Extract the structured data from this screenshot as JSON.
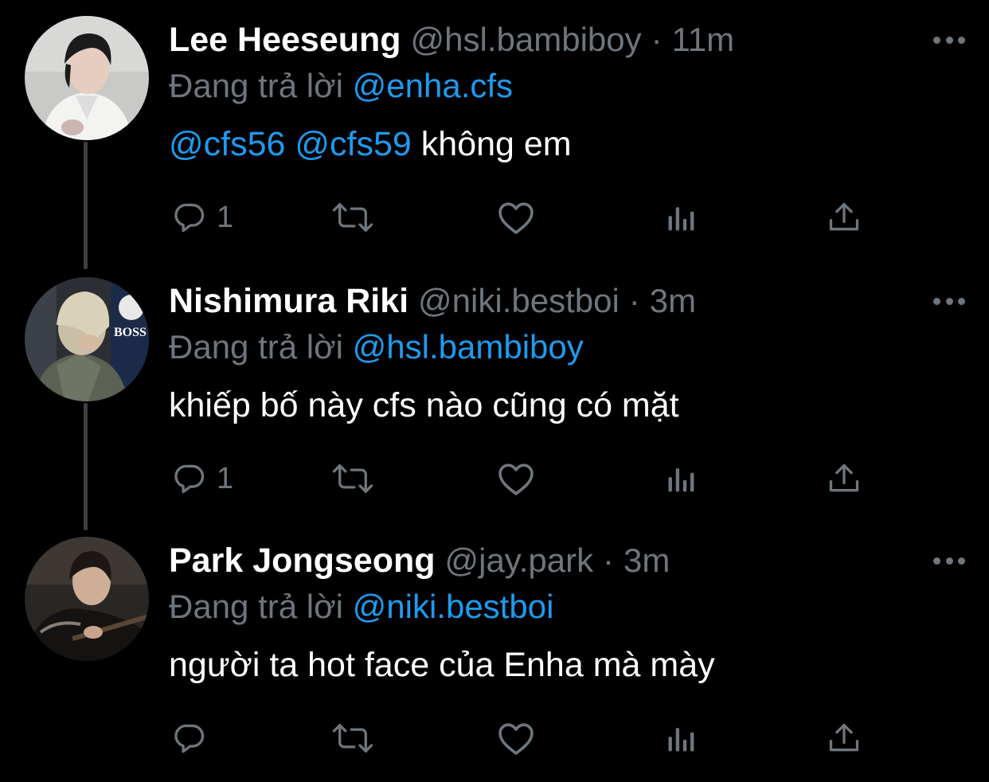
{
  "colors": {
    "background": "#000000",
    "name": "#ffffff",
    "muted": "#6e767d",
    "mention": "#1d9bf0",
    "thread_line": "#3a3f44"
  },
  "tweets": [
    {
      "name": "Lee Heeseung",
      "handle": "@hsl.bambiboy",
      "separator": "·",
      "time": "11m",
      "reply_prefix": "Đang trả lời",
      "reply_to": "@enha.cfs",
      "mention_1": "@cfs56",
      "mention_2": "@cfs59",
      "text": "không em",
      "reply_count": "1",
      "icons": [
        "reply-icon",
        "retweet-icon",
        "like-icon",
        "analytics-icon",
        "share-icon",
        "more-icon"
      ]
    },
    {
      "name": "Nishimura Riki",
      "handle": "@niki.bestboi",
      "separator": "·",
      "time": "3m",
      "reply_prefix": "Đang trả lời",
      "reply_to": "@hsl.bambiboy",
      "text": "khiếp bố này cfs nào cũng có mặt",
      "reply_count": "1",
      "icons": [
        "reply-icon",
        "retweet-icon",
        "like-icon",
        "analytics-icon",
        "share-icon",
        "more-icon"
      ]
    },
    {
      "name": "Park Jongseong",
      "handle": "@jay.park",
      "separator": "·",
      "time": "3m",
      "reply_prefix": "Đang trả lời",
      "reply_to": "@niki.bestboi",
      "text": "người ta hot face của Enha mà mày",
      "reply_count": "",
      "icons": [
        "reply-icon",
        "retweet-icon",
        "like-icon",
        "analytics-icon",
        "share-icon",
        "more-icon"
      ]
    }
  ]
}
